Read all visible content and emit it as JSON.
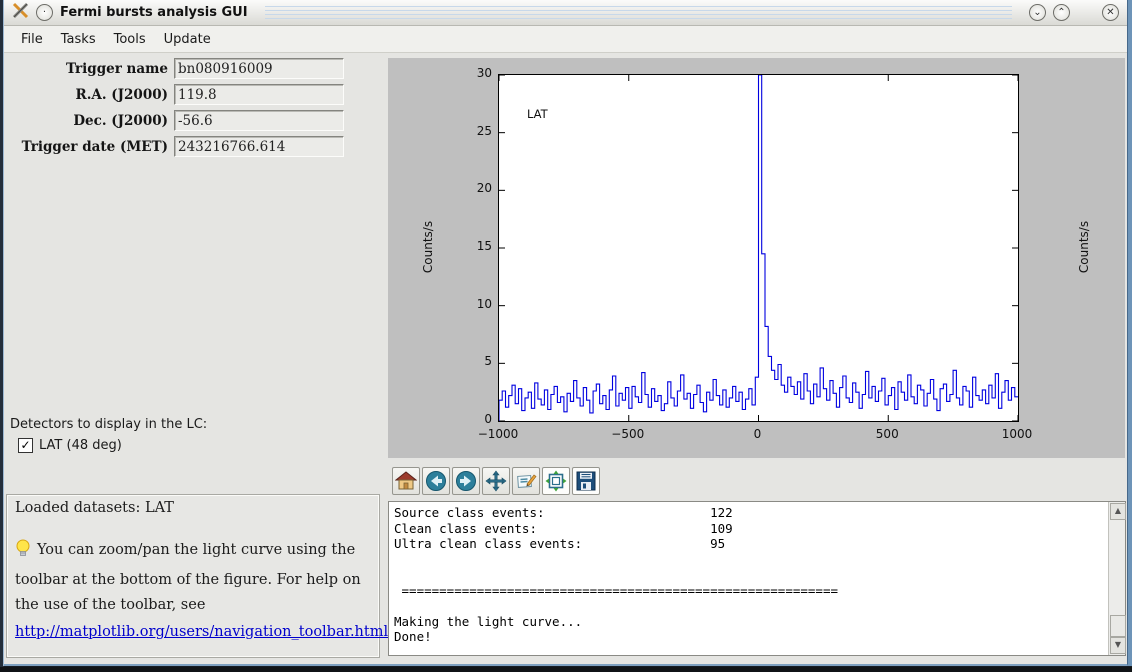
{
  "window": {
    "title": "Fermi bursts analysis GUI",
    "controls": {
      "minimize": "⌄",
      "maximize": "⌃",
      "close": "✕"
    }
  },
  "menu": {
    "items": [
      {
        "label": "File"
      },
      {
        "label": "Tasks"
      },
      {
        "label": "Tools"
      },
      {
        "label": "Update"
      }
    ]
  },
  "form": {
    "fields": [
      {
        "label": "Trigger name",
        "value": "bn080916009"
      },
      {
        "label": "R.A. (J2000)",
        "value": "119.8"
      },
      {
        "label": "Dec. (J2000)",
        "value": "-56.6"
      },
      {
        "label": "Trigger date (MET)",
        "value": "243216766.614"
      }
    ],
    "detectors_label": "Detectors to display in the LC:",
    "detector_checkbox": {
      "label": "LAT (48 deg)",
      "checked": true,
      "checkmark": "✓"
    }
  },
  "info_panel": {
    "loaded": "Loaded datasets: LAT",
    "tip": "You can zoom/pan the light curve using the toolbar at the bottom of the figure. For help on the use of the toolbar, see",
    "link": "http://matplotlib.org/users/navigation_toolbar.html"
  },
  "plot_toolbar": {
    "buttons": [
      "home",
      "back",
      "forward",
      "pan",
      "zoom",
      "subplots",
      "save"
    ]
  },
  "console": {
    "lines": [
      "Source class events:                      122",
      "Clean class events:                       109",
      "Ultra clean class events:                 95",
      "",
      "",
      " ==========================================================",
      "",
      "Making the light curve...",
      "Done!"
    ]
  },
  "chart_data": {
    "type": "line",
    "style": "step",
    "series_label": "LAT",
    "ylabel": "Counts/s",
    "xlabel": "",
    "title": "",
    "line_color": "#0000e0",
    "xlim": [
      -1000,
      1000
    ],
    "ylim": [
      0,
      30
    ],
    "xticks": [
      -1000,
      -500,
      0,
      500,
      1000
    ],
    "yticks": [
      0,
      5,
      10,
      15,
      20,
      25,
      30
    ],
    "x_start": -1000,
    "bin_width": 12.5,
    "values": [
      1.8,
      2.6,
      1.2,
      2.2,
      3.1,
      1.5,
      2.8,
      0.9,
      2.0,
      2.5,
      1.1,
      3.3,
      1.9,
      1.4,
      2.7,
      1.0,
      2.3,
      3.0,
      1.6,
      2.1,
      0.8,
      2.4,
      1.7,
      3.5,
      2.0,
      1.3,
      2.9,
      1.8,
      0.7,
      2.6,
      3.2,
      1.5,
      2.2,
      1.0,
      2.7,
      3.9,
      1.3,
      2.4,
      1.8,
      2.9,
      1.1,
      3.0,
      2.1,
      1.6,
      4.2,
      2.3,
      1.2,
      2.8,
      1.7,
      2.2,
      0.9,
      1.5,
      3.4,
      2.0,
      1.3,
      2.6,
      4.0,
      1.9,
      2.4,
      1.1,
      2.3,
      3.1,
      1.6,
      0.8,
      2.5,
      1.8,
      3.6,
      2.2,
      1.4,
      2.7,
      1.2,
      2.0,
      3.0,
      1.7,
      2.5,
      1.0,
      1.9,
      2.8,
      1.4,
      3.8,
      30,
      14.5,
      8.2,
      5.6,
      4.4,
      3.6,
      4.9,
      3.1,
      2.5,
      3.8,
      3.0,
      2.3,
      3.4,
      1.9,
      4.1,
      2.6,
      1.5,
      3.2,
      2.1,
      4.6,
      2.8,
      1.8,
      3.5,
      2.4,
      1.2,
      2.9,
      3.9,
      2.0,
      1.6,
      3.3,
      2.5,
      1.1,
      2.3,
      4.3,
      2.0,
      3.0,
      1.7,
      2.6,
      3.7,
      1.4,
      2.2,
      2.9,
      1.0,
      3.4,
      2.5,
      1.8,
      4.0,
      2.1,
      1.5,
      3.1,
      2.7,
      1.3,
      2.4,
      3.6,
      1.9,
      0.9,
      2.8,
      3.2,
      1.7,
      2.3,
      4.4,
      2.0,
      1.4,
      3.0,
      2.6,
      1.2,
      3.8,
      2.2,
      1.8,
      2.7,
      1.5,
      3.1,
      2.0,
      4.1,
      1.1,
      2.5,
      3.5,
      1.8,
      2.9,
      2.1
    ]
  }
}
